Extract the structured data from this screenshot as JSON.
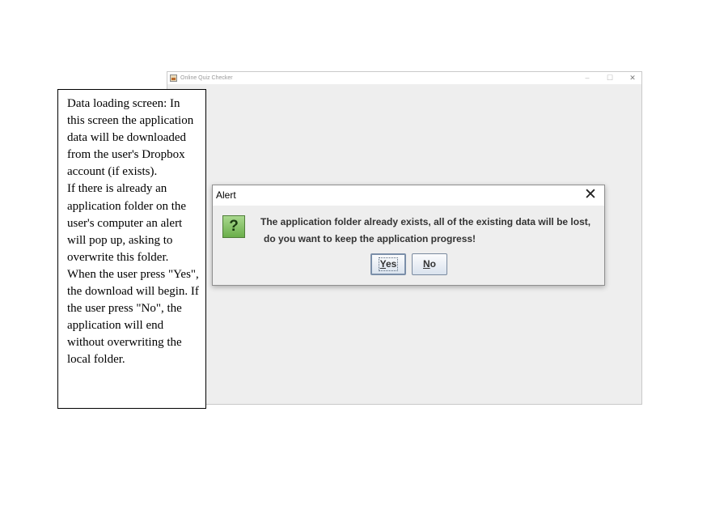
{
  "app_window": {
    "title": "Online Quiz Checker",
    "controls": {
      "minimize": "–",
      "maximize": "☐",
      "close": "✕"
    }
  },
  "note": {
    "paragraphs": [
      "Data loading screen: In this screen the application data will be downloaded from the user's Dropbox account (if exists).",
      "If there is already an application folder on the user's computer an alert will pop up, asking to overwrite this folder. When the user press \"Yes\", the download will begin. If the user press \"No\", the application will end without overwriting the local folder."
    ]
  },
  "dialog": {
    "title": "Alert",
    "close_glyph": "✕",
    "icon": {
      "name": "question-icon",
      "glyph": "?"
    },
    "message_line1": "The application folder already exists, all of the existing data will be lost,",
    "message_line2": "do you want to keep the application progress!",
    "buttons": {
      "yes": {
        "mnemonic": "Y",
        "rest": "es"
      },
      "no": {
        "mnemonic": "N",
        "rest": "o"
      }
    }
  },
  "colors": {
    "window_bg": "#eeeeee",
    "icon_green": "#6aae4a",
    "button_border": "#7a8a9f"
  }
}
